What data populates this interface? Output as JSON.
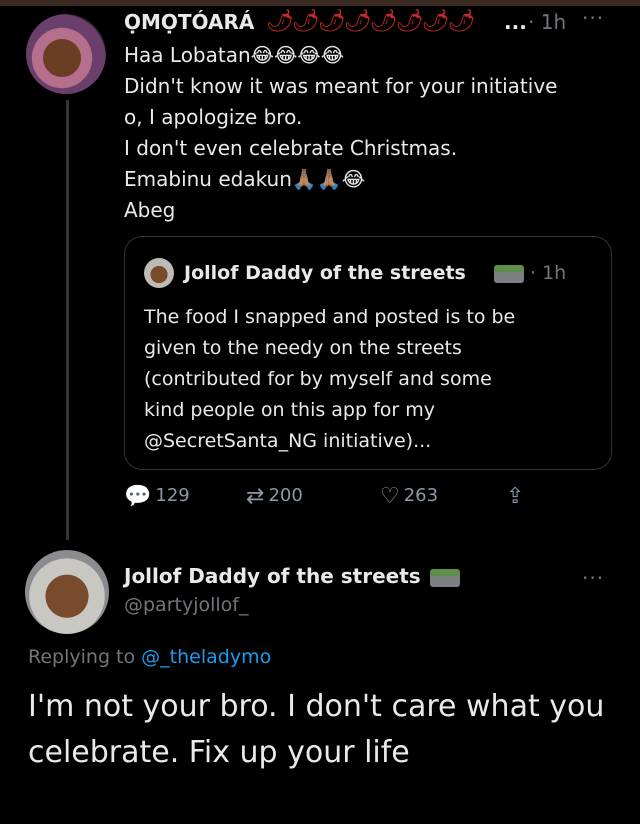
{
  "tweet1": {
    "author_name": "ỌMỌTÓARÁ",
    "name_emojis": "🌶🌶🌶🌶🌶🌶🌶🌶",
    "name_truncation": "...",
    "time": "· 1h",
    "more": "···",
    "lines": [
      "Haa Lobatan😂😂😂😂",
      "Didn't know it was meant for your initiative",
      "o, I apologize bro.",
      "I don't even celebrate Christmas.",
      "Emabinu edakun🙏🏽🙏🏽😂",
      "Abeg"
    ],
    "quote": {
      "author_name": "Jollof Daddy of the streets",
      "time": "· 1h",
      "lines": [
        "The food I snapped and posted is to be",
        "given to the needy on the streets",
        "(contributed for by myself and some",
        "kind people on this app for my",
        "@SecretSanta_NG initiative)..."
      ]
    },
    "actions": {
      "replies": "129",
      "retweets": "200",
      "likes": "263"
    }
  },
  "tweet2": {
    "author_name": "Jollof Daddy of the streets",
    "handle": "@partyjollof_",
    "more": "···",
    "replying_prefix": "Replying to",
    "replying_to": "@_theladymo",
    "lines": [
      "I'm not your bro. I don't care what you",
      "celebrate. Fix up your life"
    ]
  },
  "colors": {
    "background": "#000000",
    "text": "#e7e9ea",
    "secondary": "#71767b",
    "link": "#1d9bf0",
    "pepper": "#c62828"
  },
  "icons": {
    "reply": "reply-icon",
    "retweet": "retweet-icon",
    "like": "heart-icon",
    "share": "share-icon",
    "road": "motorway-emoji-icon"
  }
}
